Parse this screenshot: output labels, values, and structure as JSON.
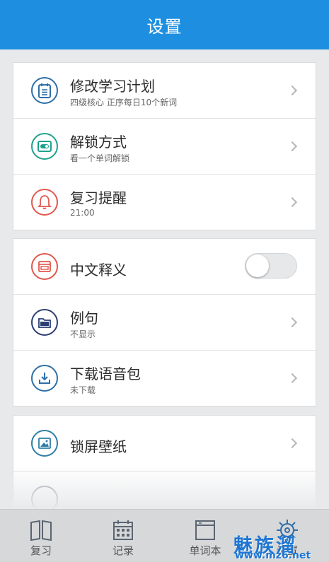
{
  "header": {
    "title": "设置"
  },
  "groups": [
    {
      "items": [
        {
          "icon": "study-plan-icon",
          "title": "修改学习计划",
          "subtitle": "四级核心 正序每日10个新词",
          "control": "chevron",
          "color": "#2e6fa8"
        },
        {
          "icon": "unlock-icon",
          "title": "解锁方式",
          "subtitle": "看一个单词解锁",
          "control": "chevron",
          "color": "#1fa18e"
        },
        {
          "icon": "bell-icon",
          "title": "复习提醒",
          "subtitle": "21:00",
          "control": "chevron",
          "color": "#e2574c"
        }
      ]
    },
    {
      "items": [
        {
          "icon": "chinese-meaning-icon",
          "title": "中文释义",
          "subtitle": "",
          "control": "toggle",
          "toggle_on": false,
          "color": "#e2574c"
        },
        {
          "icon": "folder-icon",
          "title": "例句",
          "subtitle": "不显示",
          "control": "chevron",
          "color": "#2c3e73"
        },
        {
          "icon": "download-icon",
          "title": "下载语音包",
          "subtitle": "未下载",
          "control": "chevron",
          "color": "#2e6fa8"
        }
      ]
    },
    {
      "items": [
        {
          "icon": "wallpaper-icon",
          "title": "锁屏壁纸",
          "subtitle": "",
          "control": "chevron",
          "color": "#2e7ea8"
        }
      ]
    }
  ],
  "tabbar": {
    "tabs": [
      {
        "label": "复习",
        "icon": "book-icon"
      },
      {
        "label": "记录",
        "icon": "calendar-icon"
      },
      {
        "label": "单词本",
        "icon": "wordbook-icon"
      },
      {
        "label": "设置",
        "icon": "settings-icon"
      }
    ]
  },
  "watermark": {
    "text": "魅族溜",
    "url": "www.mz6.net"
  },
  "colors": {
    "header_bg": "#1e8fe0",
    "page_bg": "#e8e9eb",
    "tabbar_bg": "#d7d8da"
  }
}
